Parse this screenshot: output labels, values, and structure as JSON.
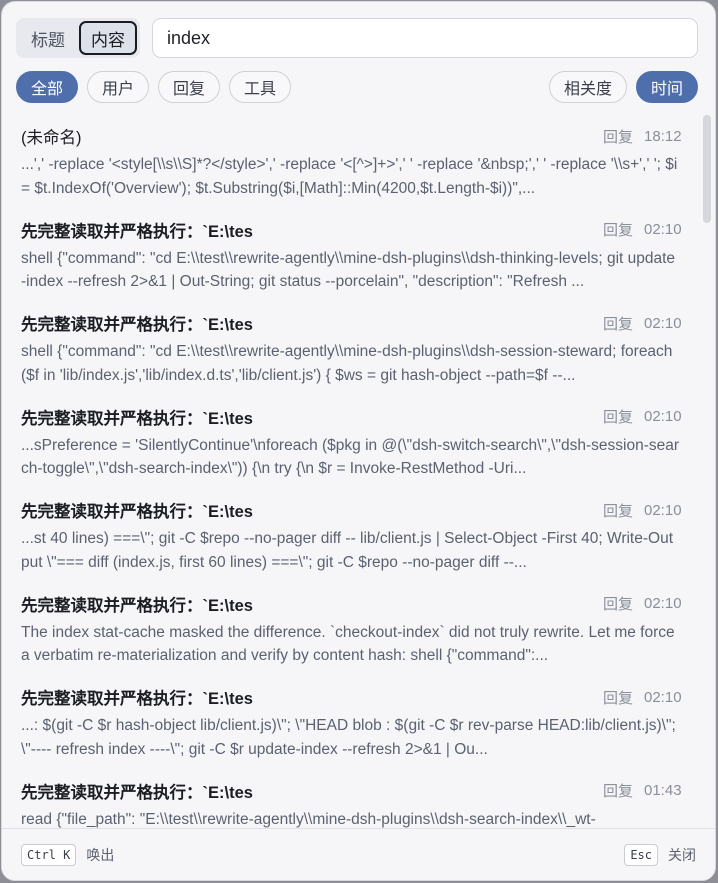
{
  "modes": {
    "title_label": "标题",
    "content_label": "内容"
  },
  "search": {
    "value": "index"
  },
  "filters": {
    "all": "全部",
    "user": "用户",
    "reply": "回复",
    "tool": "工具",
    "relevance": "相关度",
    "time": "时间"
  },
  "results": [
    {
      "title": "(未命名)",
      "tag": "回复",
      "time": "18:12",
      "snippet": "...',' -replace '<style[\\\\s\\\\S]*?</style>',' -replace '<[^>]+>',' ' -replace '&nbsp;',' ' -replace '\\\\s+',' '; $i = $t.IndexOf('Overview'); $t.Substring($i,[Math]::Min(4200,$t.Length-$i))\",..."
    },
    {
      "title": "先完整读取并严格执行：`E:\\tes",
      "tag": "回复",
      "time": "02:10",
      "snippet": "shell {\"command\": \"cd E:\\\\test\\\\rewrite-agently\\\\mine-dsh-plugins\\\\dsh-thinking-levels; git update-index --refresh 2>&1 | Out-String; git status --porcelain\", \"description\": \"Refresh ..."
    },
    {
      "title": "先完整读取并严格执行：`E:\\tes",
      "tag": "回复",
      "time": "02:10",
      "snippet": "shell {\"command\": \"cd E:\\\\test\\\\rewrite-agently\\\\mine-dsh-plugins\\\\dsh-session-steward; foreach ($f in 'lib/index.js','lib/index.d.ts','lib/client.js') { $ws = git hash-object --path=$f --..."
    },
    {
      "title": "先完整读取并严格执行：`E:\\tes",
      "tag": "回复",
      "time": "02:10",
      "snippet": "...sPreference = 'SilentlyContinue'\\nforeach ($pkg in @(\\\"dsh-switch-search\\\",\\\"dsh-session-search-toggle\\\",\\\"dsh-search-index\\\")) {\\n try {\\n $r = Invoke-RestMethod -Uri..."
    },
    {
      "title": "先完整读取并严格执行：`E:\\tes",
      "tag": "回复",
      "time": "02:10",
      "snippet": "...st 40 lines) ===\\\"; git -C $repo --no-pager diff -- lib/client.js | Select-Object -First 40; Write-Output \\\"=== diff (index.js, first 60 lines) ===\\\"; git -C $repo --no-pager diff --..."
    },
    {
      "title": "先完整读取并严格执行：`E:\\tes",
      "tag": "回复",
      "time": "02:10",
      "snippet": "The index stat-cache masked the difference. `checkout-index` did not truly rewrite. Let me force a verbatim re-materialization and verify by content hash: shell {\"command\":..."
    },
    {
      "title": "先完整读取并严格执行：`E:\\tes",
      "tag": "回复",
      "time": "02:10",
      "snippet": "...: $(git -C $r hash-object lib/client.js)\\\"; \\\"HEAD blob : $(git -C $r rev-parse HEAD:lib/client.js)\\\"; \\\"---- refresh index ----\\\"; git -C $r update-index --refresh 2>&1 | Ou..."
    },
    {
      "title": "先完整读取并严格执行：`E:\\tes",
      "tag": "回复",
      "time": "01:43",
      "snippet": "read {\"file_path\": \"E:\\\\test\\\\rewrite-agently\\\\mine-dsh-plugins\\\\dsh-search-index\\\\_wt-"
    }
  ],
  "footer": {
    "summon_key": "Ctrl K",
    "summon_label": "唤出",
    "close_key": "Esc",
    "close_label": "关闭"
  }
}
